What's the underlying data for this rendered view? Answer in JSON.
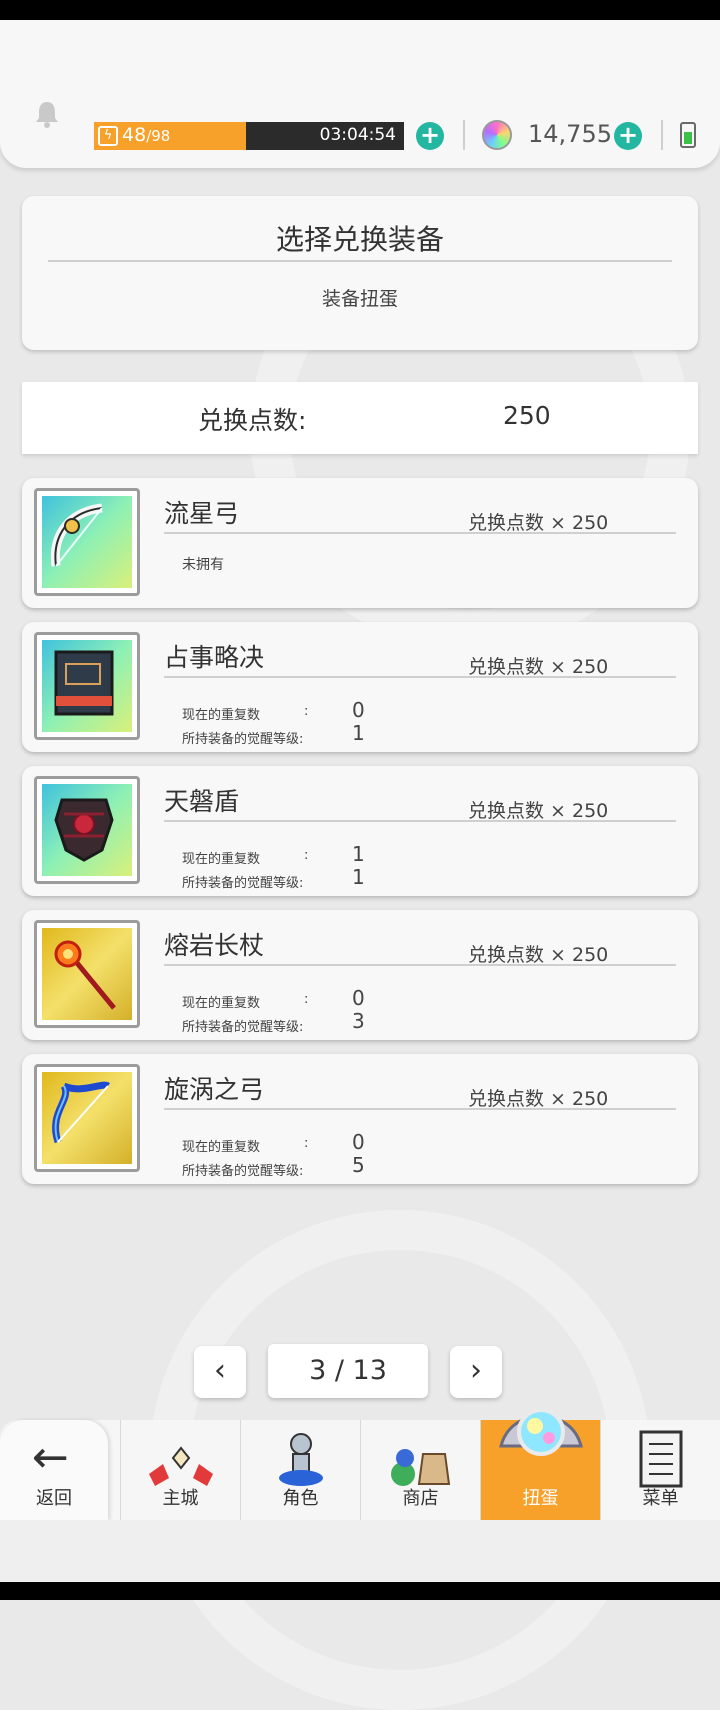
{
  "topbar": {
    "stamina_current": "48",
    "stamina_max": "/98",
    "stamina_fraction": 0.49,
    "timer": "03:04:54",
    "gems": "14,755"
  },
  "panel": {
    "title": "选择兑换装备",
    "subtitle": "装备扭蛋"
  },
  "points": {
    "label": "兑换点数:",
    "value": "250"
  },
  "stat_labels": {
    "owned_none": "未拥有",
    "repeat": "现在的重复数",
    "awaken": "所持装备的觉醒等级:",
    "colon": ":"
  },
  "items": [
    {
      "name": "流星弓",
      "cost": "兑换点数 × 250",
      "icon": "meteor-bow-icon",
      "bg": "#6fd9c5"
    },
    {
      "name": "占事略决",
      "cost": "兑换点数 × 250",
      "repeat": "0",
      "awaken": "1",
      "icon": "divination-book-icon",
      "bg": "#6fd9c5"
    },
    {
      "name": "天磐盾",
      "cost": "兑换点数 × 250",
      "repeat": "1",
      "awaken": "1",
      "icon": "heaven-shield-icon",
      "bg": "#6fd9c5"
    },
    {
      "name": "熔岩长杖",
      "cost": "兑换点数 × 250",
      "repeat": "0",
      "awaken": "3",
      "icon": "lava-staff-icon",
      "bg": "#e7c52c"
    },
    {
      "name": "旋涡之弓",
      "cost": "兑换点数 × 250",
      "repeat": "0",
      "awaken": "5",
      "icon": "vortex-bow-icon",
      "bg": "#e7c52c"
    }
  ],
  "pagination": {
    "indicator": "3 / 13",
    "prev": "‹",
    "next": "›"
  },
  "nav": {
    "back": "返回",
    "main_city": "主城",
    "character": "角色",
    "shop": "商店",
    "gacha": "扭蛋",
    "menu": "菜单"
  },
  "colors": {
    "accent_orange": "#f7a12a",
    "teal": "#23b6a1"
  }
}
